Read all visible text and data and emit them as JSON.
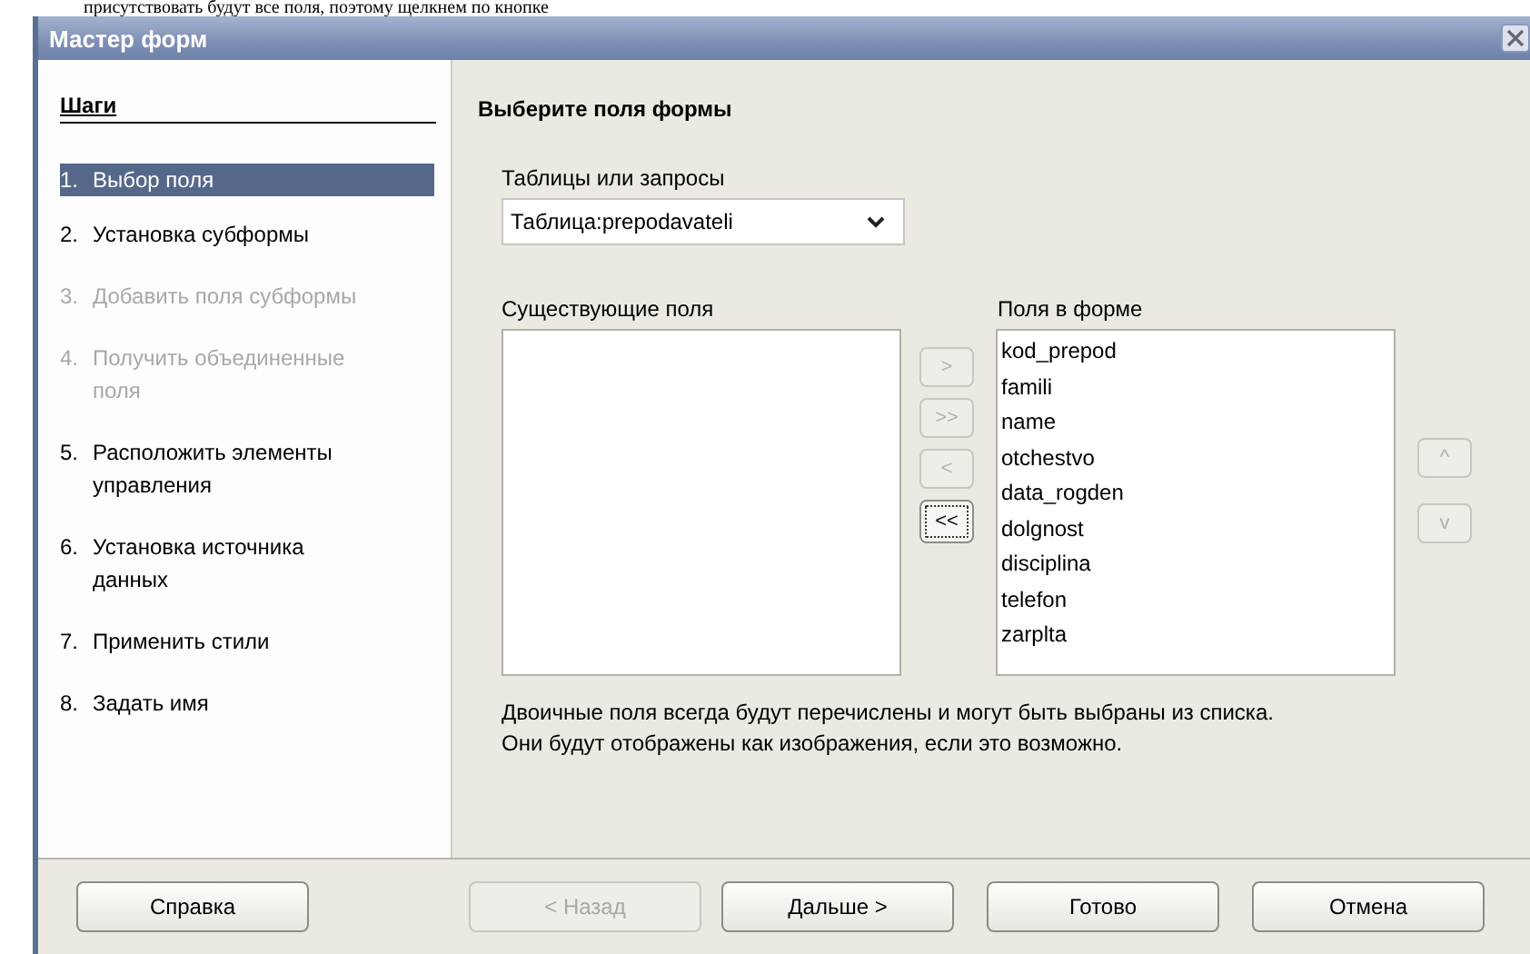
{
  "context_text": "присутствовать будут все поля, поэтому щелкнем по кнопке",
  "window": {
    "title": "Мастер форм"
  },
  "steps": {
    "title": "Шаги",
    "items": [
      {
        "number": "1.",
        "label": "Выбор поля",
        "selected": true,
        "disabled": false
      },
      {
        "number": "2.",
        "label": "Установка субформы",
        "selected": false,
        "disabled": false
      },
      {
        "number": "3.",
        "label": "Добавить поля субформы",
        "selected": false,
        "disabled": true
      },
      {
        "number": "4.",
        "label": "Получить объединенные поля",
        "selected": false,
        "disabled": true
      },
      {
        "number": "5.",
        "label": "Расположить элементы управления",
        "selected": false,
        "disabled": false
      },
      {
        "number": "6.",
        "label": "Установка источника данных",
        "selected": false,
        "disabled": false
      },
      {
        "number": "7.",
        "label": "Применить стили",
        "selected": false,
        "disabled": false
      },
      {
        "number": "8.",
        "label": "Задать имя",
        "selected": false,
        "disabled": false
      }
    ]
  },
  "page": {
    "heading": "Выберите поля формы",
    "tables_label": "Таблицы или запросы",
    "tables_value": "Таблица:prepodavateli",
    "existing_label": "Существующие поля",
    "move_buttons": [
      {
        "label": ">",
        "disabled": true,
        "focused": false
      },
      {
        "label": ">>",
        "disabled": true,
        "focused": false
      },
      {
        "label": "<",
        "disabled": true,
        "focused": false
      },
      {
        "label": "<<",
        "disabled": false,
        "focused": true
      }
    ],
    "form_label": "Поля в форме",
    "form_fields": [
      "kod_prepod",
      "famili",
      "name",
      "otchestvo",
      "data_rogden",
      "dolgnost",
      "disciplina",
      "telefon",
      "zarplta"
    ],
    "order_buttons": [
      {
        "label": "^",
        "disabled": true
      },
      {
        "label": "v",
        "disabled": true
      }
    ],
    "note": "Двоичные поля всегда будут перечислены и могут быть выбраны из списка.\nОни будут отображены как изображения, если это возможно."
  },
  "help_button": {
    "label": "Справка",
    "disabled": false
  },
  "nav_buttons": [
    {
      "label": "< Назад",
      "disabled": true
    },
    {
      "label": "Дальше >",
      "disabled": false
    },
    {
      "label": "Готово",
      "disabled": false
    },
    {
      "label": "Отмена",
      "disabled": false
    }
  ]
}
